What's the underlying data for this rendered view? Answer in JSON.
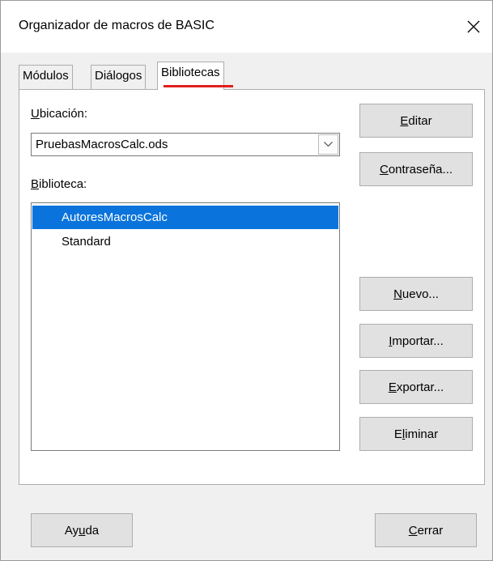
{
  "window": {
    "title": "Organizador de macros de BASIC"
  },
  "tabs": [
    {
      "label": "Módulos",
      "active": false
    },
    {
      "label": "Diálogos",
      "active": false
    },
    {
      "label": "Bibliotecas",
      "active": true
    }
  ],
  "location": {
    "label_underlined": "U",
    "label_rest": "bicación:",
    "value": "PruebasMacrosCalc.ods"
  },
  "library": {
    "label_underlined": "B",
    "label_rest": "iblioteca:",
    "items": [
      {
        "label": "AutoresMacrosCalc",
        "selected": true
      },
      {
        "label": "Standard",
        "selected": false
      }
    ]
  },
  "buttons": {
    "edit": {
      "pre": "",
      "u": "E",
      "post": "ditar"
    },
    "password": {
      "pre": "",
      "u": "C",
      "post": "ontraseña..."
    },
    "new": {
      "pre": "",
      "u": "N",
      "post": "uevo..."
    },
    "import": {
      "pre": "",
      "u": "I",
      "post": "mportar..."
    },
    "export": {
      "pre": "",
      "u": "E",
      "post": "xportar..."
    },
    "delete": {
      "pre": "E",
      "u": "l",
      "post": "iminar"
    },
    "help": {
      "pre": "Ay",
      "u": "u",
      "post": "da"
    },
    "close": {
      "pre": "",
      "u": "C",
      "post": "errar"
    }
  },
  "colors": {
    "selection": "#0a74dc",
    "active_tab_indicator": "#e0201c"
  }
}
